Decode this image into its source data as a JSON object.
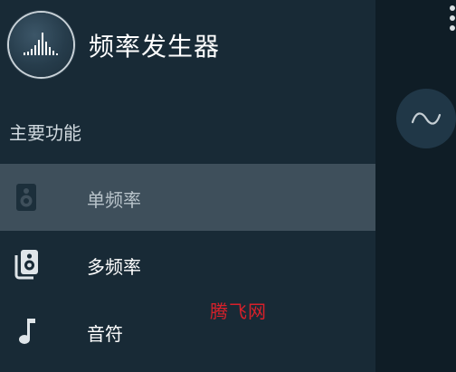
{
  "app": {
    "title": "频率发生器",
    "logo_icon": "frequency-bars-icon"
  },
  "drawer": {
    "section_label": "主要功能",
    "items": [
      {
        "label": "单频率",
        "icon": "speaker-icon",
        "active": true
      },
      {
        "label": "多频率",
        "icon": "multi-speaker-icon",
        "active": false
      },
      {
        "label": "音符",
        "icon": "music-note-icon",
        "active": false
      }
    ]
  },
  "right_panel": {
    "wave_icon": "sine-wave-icon",
    "menu_icon": "overflow-menu-icon"
  },
  "watermark": "腾飞网",
  "colors": {
    "drawer_bg": "#182a36",
    "active_item_bg": "#3e4f5b",
    "watermark": "#d8202a"
  }
}
